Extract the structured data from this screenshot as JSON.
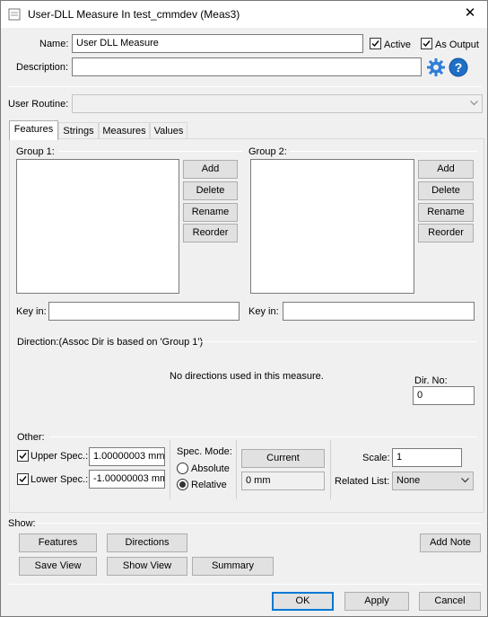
{
  "window": {
    "title": "User-DLL Measure In test_cmmdev (Meas3)",
    "close_glyph": "✕"
  },
  "header": {
    "name_label": "Name:",
    "name_value": "User DLL Measure",
    "active_label": "Active",
    "as_output_label": "As Output",
    "description_label": "Description:",
    "description_value": "",
    "user_routine_label": "User Routine:",
    "user_routine_value": ""
  },
  "tabs": [
    "Features",
    "Strings",
    "Measures",
    "Values"
  ],
  "features_tab": {
    "group1_label": "Group 1:",
    "group2_label": "Group 2:",
    "group_buttons": [
      "Add",
      "Delete",
      "Rename",
      "Reorder"
    ],
    "key_in_label": "Key in:",
    "direction_label": "Direction:(Assoc Dir is based on 'Group 1')",
    "no_directions_text": "No directions used in this measure.",
    "dir_no_label": "Dir. No:",
    "dir_no_value": "0"
  },
  "other": {
    "label": "Other:",
    "upper_spec_label": "Upper Spec.:",
    "upper_spec_value": "1.00000003 mm",
    "lower_spec_label": "Lower Spec.:",
    "lower_spec_value": "-1.00000003 mm",
    "spec_mode_label": "Spec. Mode:",
    "absolute_label": "Absolute",
    "relative_label": "Relative",
    "current_button": "Current",
    "current_value": "0 mm",
    "scale_label": "Scale:",
    "scale_value": "1",
    "related_list_label": "Related List:",
    "related_list_value": "None"
  },
  "show": {
    "label": "Show:",
    "features_button": "Features",
    "directions_button": "Directions",
    "add_note_button": "Add Note",
    "save_view_button": "Save View",
    "show_view_button": "Show View",
    "summary_button": "Summary"
  },
  "footer": {
    "ok_button": "OK",
    "apply_button": "Apply",
    "cancel_button": "Cancel"
  },
  "colors": {
    "dialog_bg": "#f0f0f0",
    "accent_blue": "#0078d7",
    "help_icon_blue": "#1f6fc5"
  },
  "icons": [
    "app-icon",
    "close-icon",
    "settings-gear-icon",
    "help-icon",
    "dropdown-arrow-icon",
    "checkmark-icon"
  ]
}
